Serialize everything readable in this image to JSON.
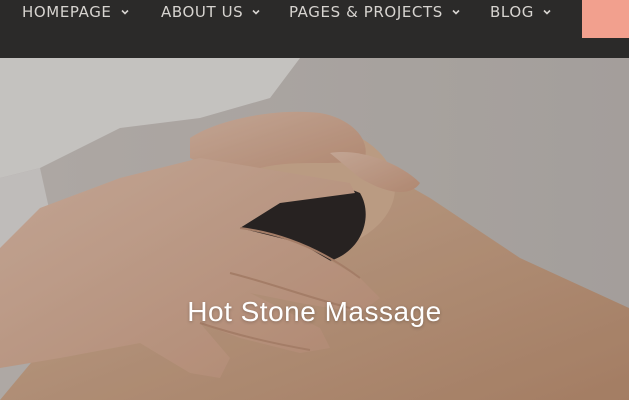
{
  "nav": {
    "items": [
      {
        "label": "HOMEPAGE"
      },
      {
        "label": "ABOUT US"
      },
      {
        "label": "PAGES & PROJECTS"
      },
      {
        "label": "BLOG"
      }
    ],
    "chevron_icon": "chevron-down-icon"
  },
  "colors": {
    "nav_background": "#2b2a29",
    "nav_text": "#d7d4d0",
    "cta": "#f2a08e",
    "title": "#ffffff"
  },
  "hero": {
    "title": "Hot Stone Massage",
    "image": "hands-on-knee-with-kinesio-tape"
  }
}
